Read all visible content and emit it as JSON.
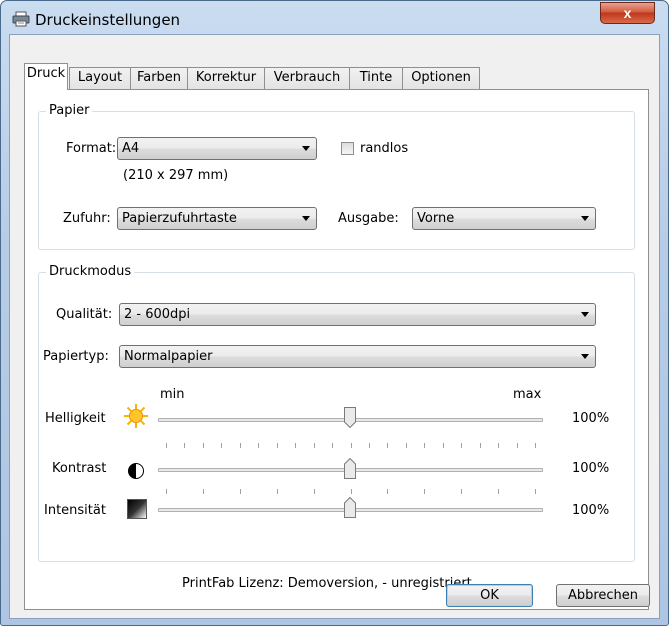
{
  "window": {
    "title": "Druckeinstellungen",
    "close_label": "x"
  },
  "tabs": [
    {
      "label": "Druck",
      "active": true
    },
    {
      "label": "Layout"
    },
    {
      "label": "Farben"
    },
    {
      "label": "Korrektur"
    },
    {
      "label": "Verbrauch"
    },
    {
      "label": "Tinte"
    },
    {
      "label": "Optionen"
    }
  ],
  "paper": {
    "group_label": "Papier",
    "format_label": "Format:",
    "format_value": "A4",
    "format_size": "(210 x 297 mm)",
    "borderless_label": "randlos",
    "borderless_checked": false,
    "feed_label": "Zufuhr:",
    "feed_value": "Papierzufuhrtaste",
    "output_label": "Ausgabe:",
    "output_value": "Vorne"
  },
  "print_mode": {
    "group_label": "Druckmodus",
    "quality_label": "Qualität:",
    "quality_value": "2 - 600dpi",
    "paper_type_label": "Papiertyp:",
    "paper_type_value": "Normalpapier",
    "scale_min": "min",
    "scale_max": "max",
    "sliders": [
      {
        "label": "Helligkeit",
        "icon": "sun-icon",
        "value_text": "100%",
        "position": 0.5
      },
      {
        "label": "Kontrast",
        "icon": "contrast-icon",
        "value_text": "100%",
        "position": 0.5
      },
      {
        "label": "Intensität",
        "icon": "intensity-gradient-icon",
        "value_text": "100%",
        "position": 0.5
      }
    ]
  },
  "license_text": "PrintFab Lizenz: Demoversion,  - unregistriert",
  "buttons": {
    "ok": "OK",
    "cancel": "Abbrechen"
  }
}
